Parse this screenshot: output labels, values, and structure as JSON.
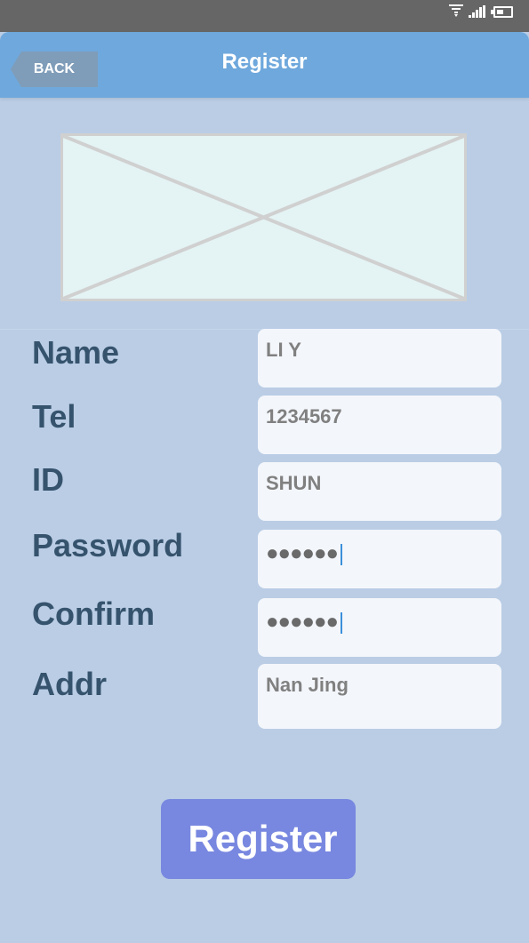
{
  "status_bar": {
    "icons": [
      "wifi-icon",
      "signal-icon",
      "battery-icon"
    ],
    "background": "#666666"
  },
  "header": {
    "back_label": "BACK",
    "title": "Register",
    "background": "#6fa8dc"
  },
  "image_placeholder": {
    "icon": "image-placeholder-icon"
  },
  "form": {
    "fields": [
      {
        "label": "Name",
        "value": "LI Y"
      },
      {
        "label": "Tel",
        "value": "1234567"
      },
      {
        "label": "ID",
        "value": "SHUN"
      },
      {
        "label": "Password",
        "value": "●●●●●●"
      },
      {
        "label": "Confirm",
        "value": "●●●●●●"
      },
      {
        "label": "Addr",
        "value": "Nan Jing"
      }
    ]
  },
  "register_button": {
    "label": "Register",
    "background": "#7888e0"
  },
  "colors": {
    "page_background": "#bacde5",
    "label_text": "#36536d",
    "input_background": "#f3f6fb",
    "cursor": "#3a8fd9"
  }
}
